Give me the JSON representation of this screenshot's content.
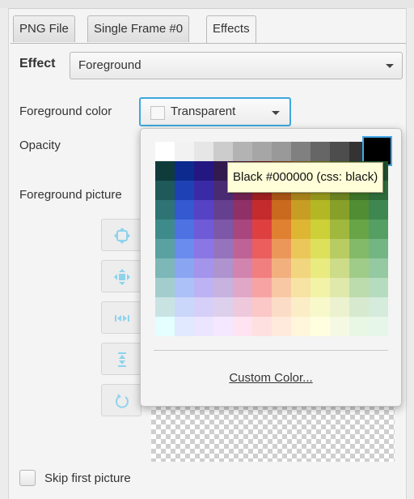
{
  "tabs": [
    "PNG File",
    "Single Frame #0",
    "Effects"
  ],
  "effect": {
    "label": "Effect",
    "value": "Foreground"
  },
  "foreground_color": {
    "label": "Foreground color",
    "value": "Transparent"
  },
  "opacity_label": "Opacity",
  "foreground_picture_label": "Foreground picture",
  "tool_buttons": [
    {
      "name": "fit-all-icon"
    },
    {
      "name": "fit-move-icon"
    },
    {
      "name": "fit-width-icon"
    },
    {
      "name": "fit-height-icon"
    },
    {
      "name": "rotate-icon"
    }
  ],
  "skip_first_picture": {
    "label": "Skip first picture",
    "checked": false
  },
  "palette": {
    "grays": [
      "#ffffff",
      "#f2f2f2",
      "#e6e6e6",
      "#cccccc",
      "#b3b3b3",
      "#a6a6a6",
      "#999999",
      "#808080",
      "#666666",
      "#4d4d4d",
      "#333333"
    ],
    "rows": [
      [
        "#0f3b3b",
        "#0d2b8f",
        "#241782",
        "#321a4f",
        "#4b1735",
        "#6b1414",
        "#7a3a10",
        "#7a5c12",
        "#6c6e13",
        "#4b5c17",
        "#26531d",
        "#1f4f2a"
      ],
      [
        "#1f5959",
        "#1e42b5",
        "#3a2aa6",
        "#4a2a72",
        "#6e2150",
        "#9b1f1f",
        "#a65216",
        "#a57f19",
        "#93951b",
        "#6a8120",
        "#3b7227",
        "#2e6b3a"
      ],
      [
        "#2e7474",
        "#3459d1",
        "#5642c4",
        "#654090",
        "#8f3067",
        "#c42c2c",
        "#c96a1e",
        "#c79e23",
        "#b4b724",
        "#87a02a",
        "#508d33",
        "#3f8750"
      ],
      [
        "#3f8b8b",
        "#4f72e3",
        "#6f5ad8",
        "#7d57a8",
        "#a9467d",
        "#de4040",
        "#df8130",
        "#dfb534",
        "#cdd036",
        "#a0b83d",
        "#67a546",
        "#559f64"
      ],
      [
        "#5aa1a1",
        "#6a8cee",
        "#8a76e4",
        "#9673bd",
        "#bf6295",
        "#ea5e5e",
        "#eb975a",
        "#ebc759",
        "#dde05b",
        "#b9cc63",
        "#83ba69",
        "#74b584"
      ],
      [
        "#7db7b7",
        "#8aa6f3",
        "#a494ec",
        "#ae93cf",
        "#d184ad",
        "#f27f7f",
        "#f2b07f",
        "#f2d67f",
        "#e9eb80",
        "#cddc88",
        "#a0cc8a",
        "#95c9a1"
      ],
      [
        "#a3cdcd",
        "#acc1f7",
        "#bdb2f3",
        "#c7b2e0",
        "#e1a7c7",
        "#f7a3a3",
        "#f7c8a3",
        "#f7e3a3",
        "#f2f3a6",
        "#dfe9ac",
        "#bcdcad",
        "#b6dcbf"
      ],
      [
        "#c9e3e3",
        "#cbd7fa",
        "#d6cff8",
        "#ddd0ed",
        "#eec9dc",
        "#fbc7c7",
        "#fbdcc7",
        "#fbeec7",
        "#f8f9cb",
        "#ecf2cf",
        "#d7ead0",
        "#d5ebdb"
      ],
      [
        "#e3ffff",
        "#e0e9ff",
        "#ebe5ff",
        "#f3e8ff",
        "#ffe3f1",
        "#ffe0e0",
        "#ffeadb",
        "#fff6db",
        "#ffffe0",
        "#f5f9e3",
        "#e8f6e4",
        "#e6f7e9"
      ]
    ],
    "selected": "#000000",
    "custom_link": "Custom Color..."
  },
  "tooltip": "Black #000000 (css: black)"
}
